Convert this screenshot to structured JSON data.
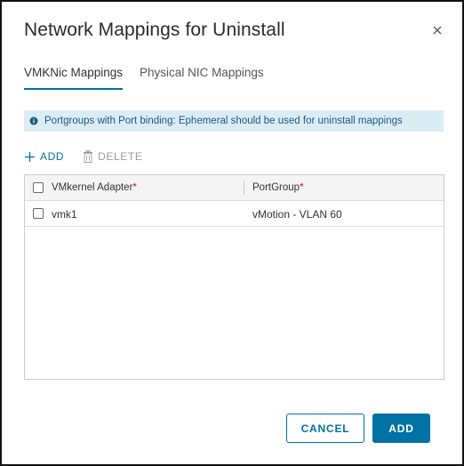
{
  "dialog": {
    "title": "Network Mappings for Uninstall"
  },
  "tabs": [
    {
      "label": "VMKNic Mappings",
      "active": true
    },
    {
      "label": "Physical NIC Mappings",
      "active": false
    }
  ],
  "alert": {
    "text": "Portgroups with Port binding: Ephemeral should be used for uninstall mappings"
  },
  "toolbar": {
    "add_label": "ADD",
    "delete_label": "DELETE"
  },
  "table": {
    "columns": [
      {
        "label": "VMkernel Adapter",
        "required_marker": "*"
      },
      {
        "label": "PortGroup",
        "required_marker": "*"
      }
    ],
    "rows": [
      {
        "adapter": "vmk1",
        "portgroup": "vMotion - VLAN 60",
        "selected": false
      }
    ]
  },
  "footer": {
    "cancel_label": "CANCEL",
    "add_label": "ADD"
  },
  "colors": {
    "primary": "#0072a3",
    "alert_bg": "#dcecf4",
    "required": "#c21d00"
  }
}
